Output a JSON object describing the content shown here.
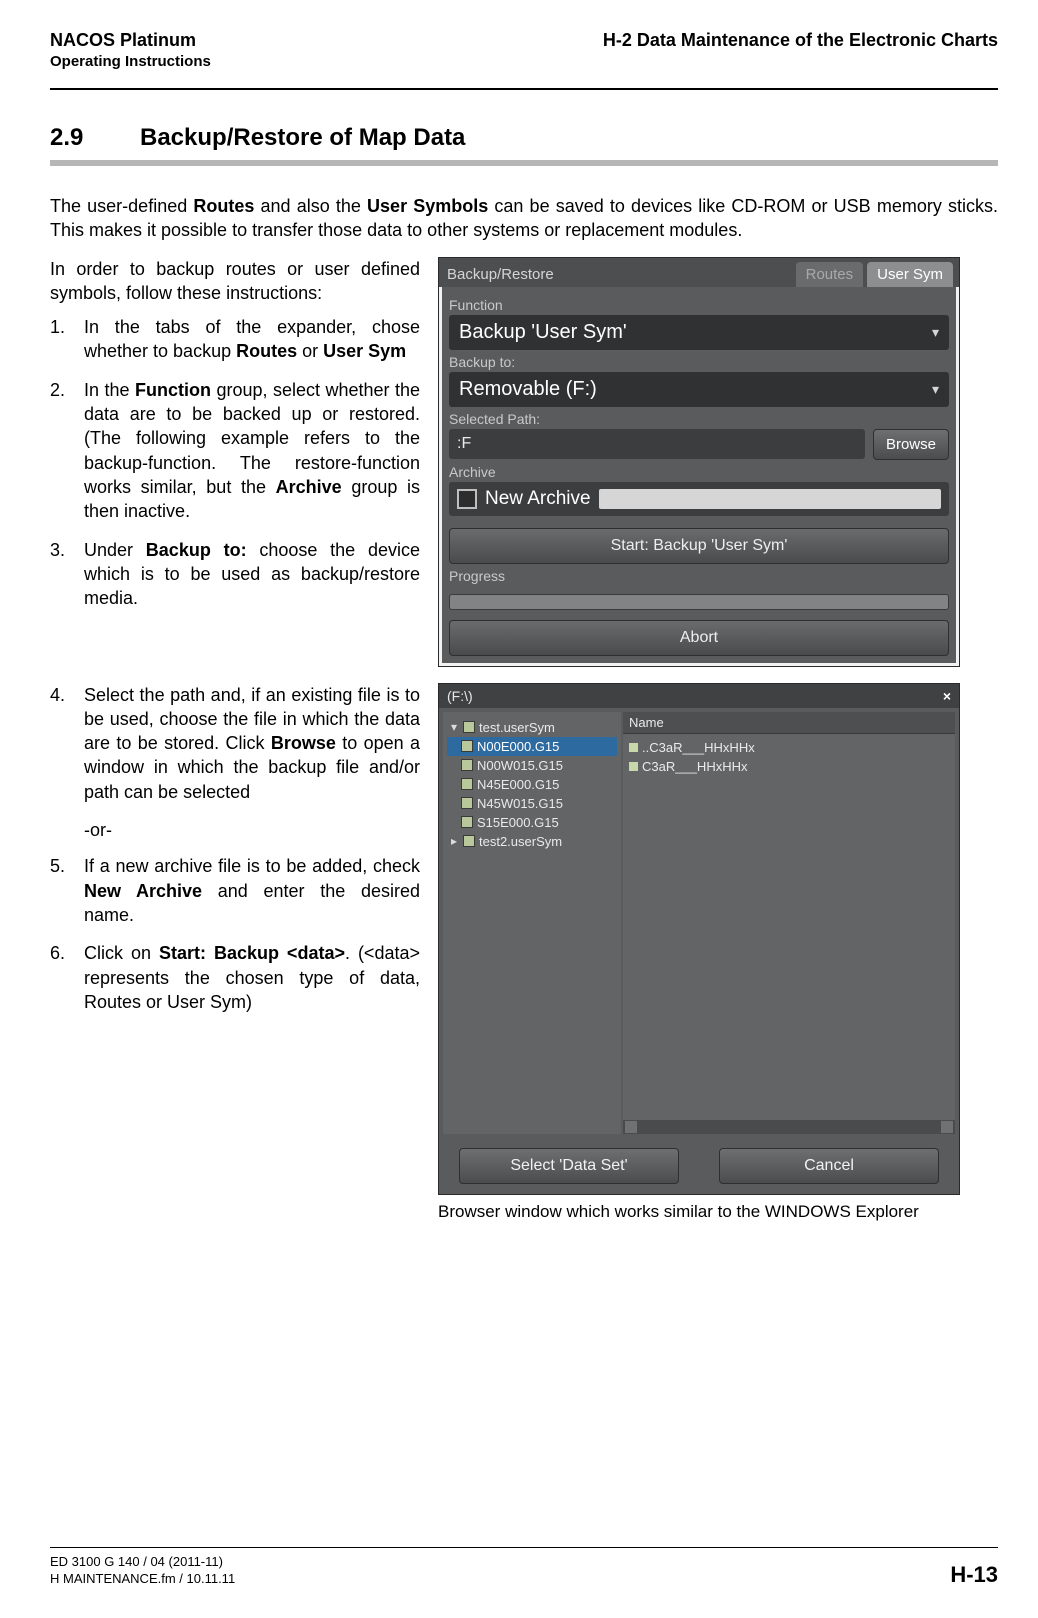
{
  "header": {
    "left_title": "NACOS Platinum",
    "left_sub": "Operating Instructions",
    "right": "H-2   Data Maintenance of the Electronic Charts"
  },
  "section": {
    "number": "2.9",
    "title": "Backup/Restore of Map Data"
  },
  "intro": {
    "p1a": "The user-defined ",
    "p1b": "Routes",
    "p1c": " and also the ",
    "p1d": "User Symbols",
    "p1e": " can be saved to devices like CD-ROM or USB memory sticks. This makes it possible to transfer those data to other systems or replacement modules.",
    "p2": "In order to backup routes or user defined symbols, follow these instructions:"
  },
  "steps": {
    "s1a": "In the tabs of the expander, chose whether to backup ",
    "s1b": "Routes",
    "s1c": " or ",
    "s1d": "User Sym",
    "s2a": "In the ",
    "s2b": "Function",
    "s2c": " group, select whether the data are to be backed up or restored. (The following example refers to the backup-function. The restore-function works similar, but the ",
    "s2d": "Archive",
    "s2e": " group is then inactive.",
    "s3a": "Under ",
    "s3b": "Backup to:",
    "s3c": " choose the device which is to be used as backup/restore media.",
    "s4a": "Select the path and, if an existing file is to be used, choose the file in which the data are to be stored. Click ",
    "s4b": "Browse",
    "s4c": " to open a window in which the backup file and/or path can be selected",
    "or": "-or-",
    "s5a": "If a new archive file is to be added, check ",
    "s5b": "New Archive",
    "s5c": " and enter the desired name.",
    "s6a": "Click on ",
    "s6b": "Start: Backup <data>",
    "s6c": ". (<data> represents the chosen type of data, Routes or User Sym)"
  },
  "shot1": {
    "tab_title": "Backup/Restore",
    "tab_routes": "Routes",
    "tab_usersym": "User Sym",
    "grp_function": "Function",
    "function_value": "Backup 'User Sym'",
    "grp_backupto": "Backup to:",
    "backupto_value": "Removable (F:)",
    "selpath_label": "Selected Path:",
    "selpath_value": ":F",
    "browse_btn": "Browse",
    "grp_archive": "Archive",
    "newarchive_label": "New Archive",
    "start_btn": "Start: Backup 'User Sym'",
    "grp_progress": "Progress",
    "abort_btn": "Abort"
  },
  "shot2": {
    "title": "(F:\\)",
    "close": "×",
    "col_name": "Name",
    "tree": {
      "n1": "test.userSym",
      "c1": "N00E000.G15",
      "c2": "N00W015.G15",
      "c3": "N45E000.G15",
      "c4": "N45W015.G15",
      "c5": "S15E000.G15",
      "n2": "test2.userSym"
    },
    "list": {
      "i1": "..C3aR___HHxHHx",
      "i2": "C3aR___HHxHHx"
    },
    "btn_select": "Select 'Data Set'",
    "btn_cancel": "Cancel"
  },
  "caption": "Browser window which works similar to the WINDOWS Explorer",
  "footer": {
    "l1": "ED 3100 G 140 / 04 (2011-11)",
    "l2": "H MAINTENANCE.fm / 10.11.11",
    "right": "H-13"
  }
}
